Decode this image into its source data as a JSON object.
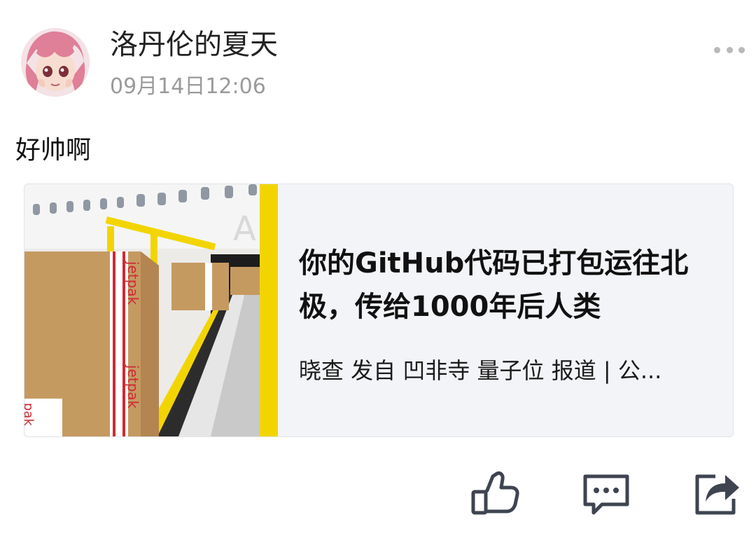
{
  "post": {
    "user_name": "洛丹伦的夏天",
    "timestamp": "09月14日12:06",
    "text": "好帅啊"
  },
  "link_card": {
    "title": "你的GitHub代码已打包运往北极，传给1000年后人类",
    "meta": "晓查 发自 凹非寺 量子位 报道 | 公...",
    "thumbnail_text": "jetpak",
    "thumbnail_text_alt": "jetpak",
    "thumbnail_text_small": "pak",
    "thumbnail_plane_letter": "A"
  },
  "actions": {
    "like_icon": "thumbs-up-icon",
    "comment_icon": "comment-icon",
    "share_icon": "share-icon"
  }
}
